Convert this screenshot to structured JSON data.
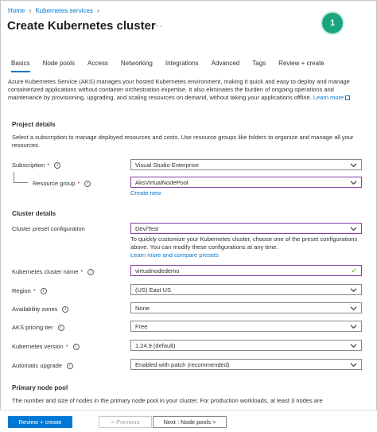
{
  "breadcrumb": {
    "home": "Home",
    "services": "Kubernetes services"
  },
  "page": {
    "title": "Create Kubernetes cluster",
    "more": "···"
  },
  "badge": {
    "number": "1",
    "color": "#18a57e"
  },
  "tabs": [
    {
      "label": "Basics",
      "active": true
    },
    {
      "label": "Node pools"
    },
    {
      "label": "Access"
    },
    {
      "label": "Networking"
    },
    {
      "label": "Integrations"
    },
    {
      "label": "Advanced"
    },
    {
      "label": "Tags"
    },
    {
      "label": "Review + create"
    }
  ],
  "intro": {
    "text": "Azure Kubernetes Service (AKS) manages your hosted Kubernetes environment, making it quick and easy to deploy and manage containerized applications without container orchestration expertise. It also eliminates the burden of ongoing operations and maintenance by provisioning, upgrading, and scaling resources on demand, without taking your applications offline.",
    "learn_more": "Learn more"
  },
  "project": {
    "heading": "Project details",
    "text": "Select a subscription to manage deployed resources and costs. Use resource groups like folders to organize and manage all your resources.",
    "subscription_label": "Subscription",
    "subscription_value": "Visual Studio Enterprise",
    "rg_label": "Resource group",
    "rg_value": "AksVirtualNodePool",
    "create_new": "Create new"
  },
  "cluster": {
    "heading": "Cluster details",
    "preset_label": "Cluster preset configuration",
    "preset_value": "Dev/Test",
    "preset_hint": "To quickly customize your Kubernetes cluster, choose one of the preset configurations above. You can modify these configurations at any time.",
    "preset_link": "Learn more and compare presets",
    "name_label": "Kubernetes cluster name",
    "name_value": "virtualnodedemo",
    "region_label": "Region",
    "region_value": "(US) East US",
    "zones_label": "Availability zones",
    "zones_value": "None",
    "pricing_label": "AKS pricing tier",
    "pricing_value": "Free",
    "version_label": "Kubernetes version",
    "version_value": "1.24.9 (default)",
    "upgrade_label": "Automatic upgrade",
    "upgrade_value": "Enabled with patch (recommended)"
  },
  "primary_pool": {
    "heading": "Primary node pool",
    "text": "The number and size of nodes in the primary node pool in your cluster. For production workloads, at least 3 nodes are"
  },
  "footer": {
    "review": "Review + create",
    "previous": "< Previous",
    "next": "Next : Node pools >"
  },
  "symbols": {
    "required": "*",
    "info": "i",
    "check": "✓"
  }
}
